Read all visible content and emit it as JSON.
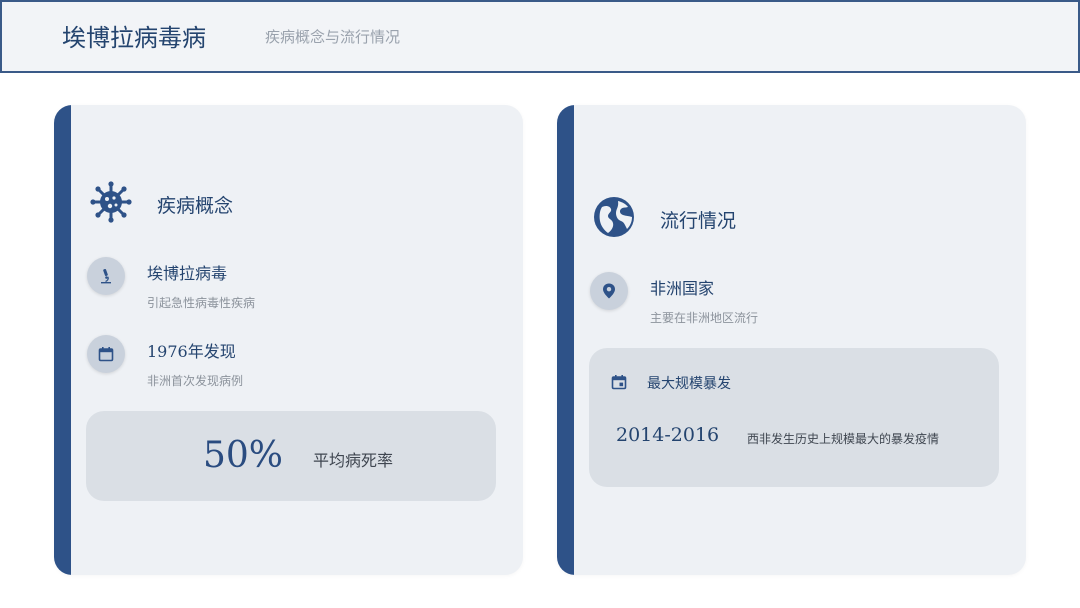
{
  "header": {
    "title": "埃博拉病毒病",
    "subtitle": "疾病概念与流行情况"
  },
  "concept": {
    "title": "疾病概念",
    "icon": "virus-icon",
    "items": [
      {
        "icon": "microscope-icon",
        "title": "埃博拉病毒",
        "desc": "引起急性病毒性疾病"
      },
      {
        "icon": "calendar-icon",
        "title": "1976年发现",
        "desc": "非洲首次发现病例"
      }
    ],
    "stat": {
      "value": "50%",
      "label": "平均病死率"
    }
  },
  "epidemic": {
    "title": "流行情况",
    "icon": "globe-icon",
    "item": {
      "icon": "location-pin-icon",
      "title": "非洲国家",
      "desc": "主要在非洲地区流行"
    },
    "box": {
      "icon": "calendar-event-icon",
      "title": "最大规模暴发",
      "years": "2014-2016",
      "desc": "西非发生历史上规模最大的暴发疫情"
    }
  },
  "colors": {
    "accent": "#2e5288",
    "card_bg": "#eef1f5",
    "box_bg": "#dadfe5",
    "circle_bg": "#c9d1dc"
  }
}
